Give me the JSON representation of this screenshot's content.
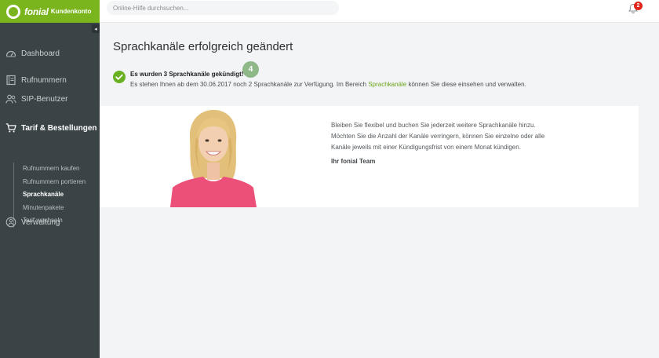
{
  "topbar": {
    "brand_name": "fonial",
    "brand_sub": "Kundenkonto",
    "search_placeholder": "Online-Hilfe durchsuchen...",
    "notification_count": "2"
  },
  "sidebar": {
    "collapse_glyph": "◂",
    "items": [
      {
        "label": "Dashboard",
        "icon": "gauge-icon"
      },
      {
        "label": "Rufnummern",
        "icon": "phone-book-icon"
      },
      {
        "label": "SIP-Benutzer",
        "icon": "users-icon"
      },
      {
        "label": "Tarif & Bestellungen",
        "icon": "cart-icon"
      },
      {
        "label": "Verwaltung",
        "icon": "settings-circle-icon"
      }
    ],
    "sub_items": [
      {
        "label": "Rufnummern kaufen"
      },
      {
        "label": "Rufnummern portieren"
      },
      {
        "label": "Sprachkanäle"
      },
      {
        "label": "Minutenpakete"
      },
      {
        "label": "Tarif wechseln"
      }
    ]
  },
  "main": {
    "title": "Sprachkanäle erfolgreich geändert",
    "step_badge": "4",
    "message_title": "Es wurden 3 Sprachkanäle gekündigt!",
    "message_text_before": "Es stehen Ihnen ab dem 30.06.2017 noch 2 Sprachkanäle zur Verfügung. Im Bereich ",
    "message_link": "Sprachkanäle",
    "message_text_after": " können Sie diese einsehen und verwalten."
  },
  "promo": {
    "lines": [
      "Bleiben Sie flexibel und buchen Sie jederzeit weitere Sprachkanäle hinzu.",
      "Möchten Sie die Anzahl der Kanäle verringern, können Sie einzelne oder alle",
      "Kanäle jeweils mit einer Kündigungsfrist von einem Monat kündigen."
    ],
    "signature": "Ihr fonial Team"
  },
  "colors": {
    "brand_green": "#7ab51d",
    "sidebar_bg": "#3a4447",
    "success_green": "#6ab023",
    "badge_red": "#e2231a"
  }
}
